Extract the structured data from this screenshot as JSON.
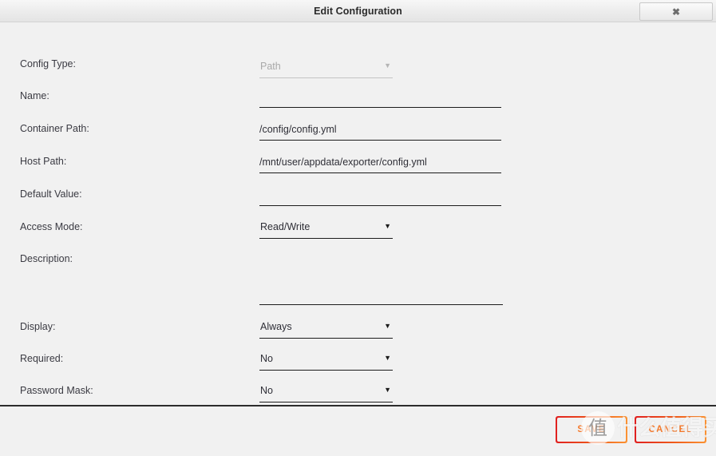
{
  "window": {
    "title": "Edit Configuration",
    "close_icon": "close-icon",
    "close_glyph": "✖"
  },
  "form": {
    "fields": [
      {
        "name": "config-type",
        "label": "Config Type:",
        "type": "select",
        "value": "Path",
        "disabled": true,
        "caret": "▼"
      },
      {
        "name": "name",
        "label": "Name:",
        "type": "text",
        "value": "",
        "placeholder": ""
      },
      {
        "name": "container-path",
        "label": "Container Path:",
        "type": "text",
        "value": "/config/config.yml",
        "placeholder": ""
      },
      {
        "name": "host-path",
        "label": "Host Path:",
        "type": "text",
        "value": "/mnt/user/appdata/exporter/config.yml",
        "placeholder": ""
      },
      {
        "name": "default-value",
        "label": "Default Value:",
        "type": "text",
        "value": "",
        "placeholder": ""
      },
      {
        "name": "access-mode",
        "label": "Access Mode:",
        "type": "select",
        "value": "Read/Write",
        "disabled": false,
        "caret": "▼"
      },
      {
        "name": "description",
        "label": "Description:",
        "type": "textarea",
        "value": "",
        "placeholder": ""
      },
      {
        "name": "display",
        "label": "Display:",
        "type": "select",
        "value": "Always",
        "disabled": false,
        "caret": "▼"
      },
      {
        "name": "required",
        "label": "Required:",
        "type": "select",
        "value": "No",
        "disabled": false,
        "caret": "▼"
      },
      {
        "name": "password-mask",
        "label": "Password Mask:",
        "type": "select",
        "value": "No",
        "disabled": false,
        "caret": "▼"
      }
    ]
  },
  "footer": {
    "save_label": "SAVE",
    "cancel_label": "CANCEL"
  },
  "watermark": {
    "badge_glyph": "值",
    "text": "什么值得买"
  },
  "colors": {
    "background": "#f1f1f1",
    "accent_start": "#e02020",
    "accent_end": "#fb9333",
    "button_text": "#f4792b",
    "label_text": "#3a3a42",
    "input_underline": "#1c1c1c",
    "disabled_text": "#a9a9a9"
  }
}
